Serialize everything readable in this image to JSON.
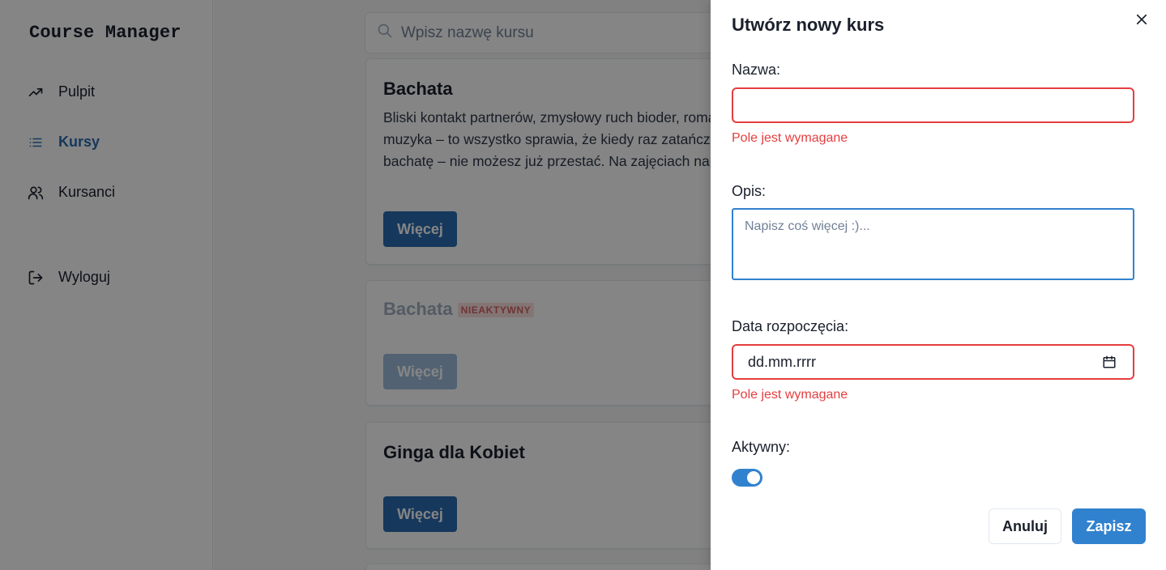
{
  "app": {
    "title": "Course Manager"
  },
  "sidebar": {
    "items": [
      {
        "label": "Pulpit",
        "icon": "trending-up-icon"
      },
      {
        "label": "Kursy",
        "icon": "list-icon",
        "active": true
      },
      {
        "label": "Kursanci",
        "icon": "users-icon"
      },
      {
        "label": "Wyloguj",
        "icon": "logout-icon"
      }
    ]
  },
  "search": {
    "placeholder": "Wpisz nazwę kursu",
    "value": ""
  },
  "courses": [
    {
      "title": "Bachata",
      "description": "Bliski kontakt partnerów, zmysłowy ruch bioder, romantyczna muzyka – to wszystko sprawia, że kiedy raz zatańczysz bachatę – nie możesz już przestać. Na zajęciach nauczysz się kroków podstawowych, obrotów a także wielu innych figur tanecznych i zmysłowej techniki",
      "button": "Więcej"
    },
    {
      "title": "Bachata",
      "badge": "NIEAKTYWNY",
      "button": "Więcej"
    },
    {
      "title": "Ginga dla Kobiet",
      "button": "Więcej"
    }
  ],
  "drawer": {
    "title": "Utwórz nowy kurs",
    "name_label": "Nazwa:",
    "name_value": "",
    "name_error": "Pole jest wymagane",
    "description_label": "Opis:",
    "description_placeholder": "Napisz coś więcej :)...",
    "date_label": "Data rozpoczęcia:",
    "date_placeholder": "dd.mm.rrrr",
    "date_error": "Pole jest wymagane",
    "active_label": "Aktywny:",
    "active_on": true,
    "cancel_label": "Anuluj",
    "save_label": "Zapisz"
  },
  "colors": {
    "accent": "#3182ce",
    "nav_active": "#2b6cb0",
    "error": "#e53e3e",
    "overlay": "rgba(0,0,0,0.48)"
  }
}
